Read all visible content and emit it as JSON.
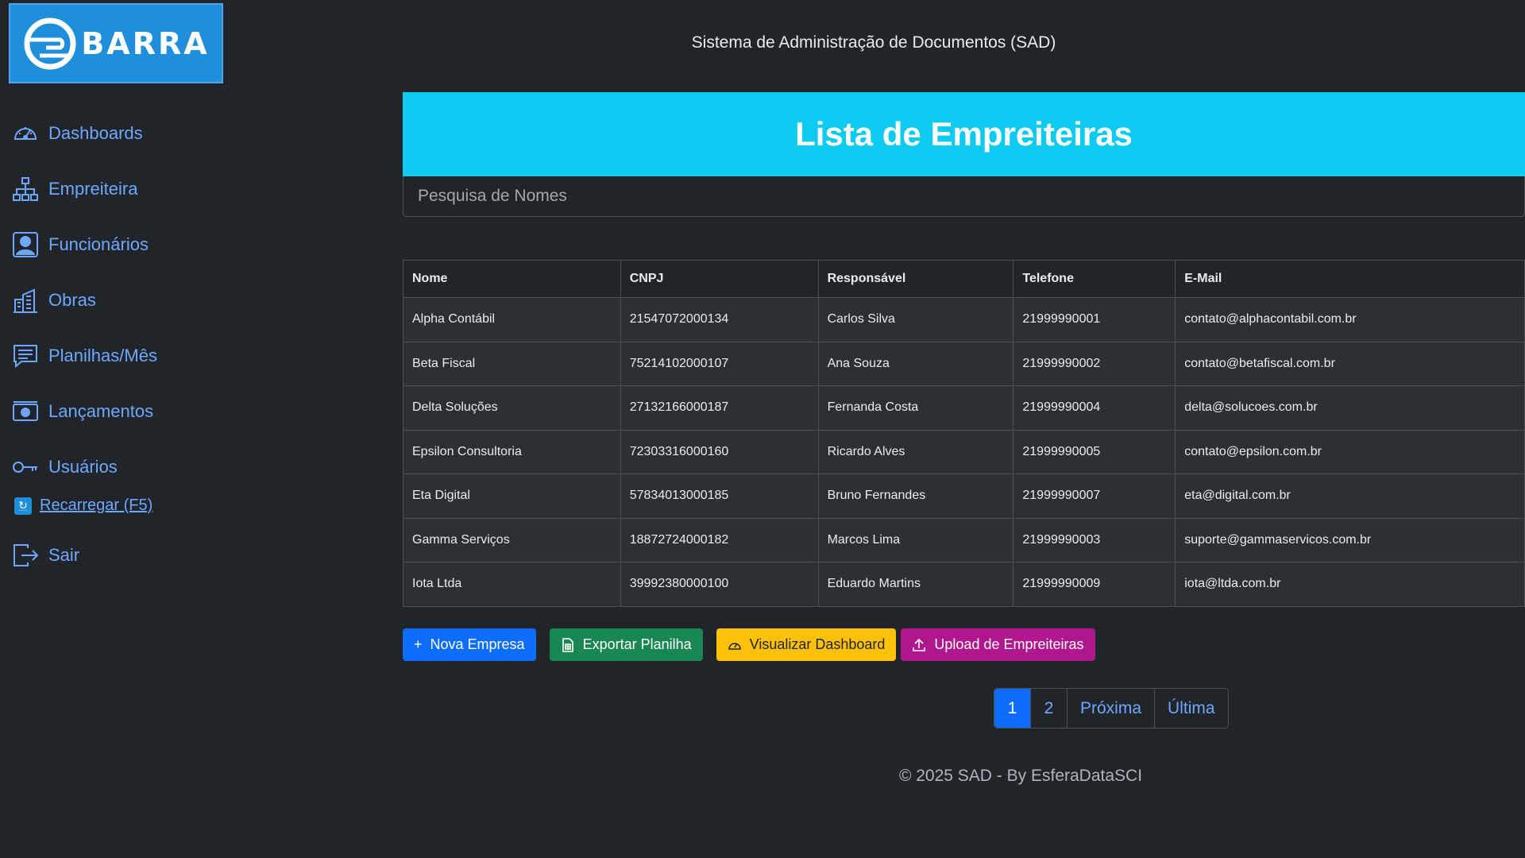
{
  "logo": {
    "text": "BARRA"
  },
  "header": {
    "system_title": "Sistema de Administração de Documentos (SAD)"
  },
  "sidebar": {
    "items": [
      {
        "label": "Dashboards",
        "icon": "speedometer-icon"
      },
      {
        "label": "Empreiteira",
        "icon": "org-chart-icon"
      },
      {
        "label": "Funcionários",
        "icon": "person-icon"
      },
      {
        "label": "Obras",
        "icon": "buildings-icon"
      },
      {
        "label": "Planilhas/Mês",
        "icon": "chat-lines-icon"
      },
      {
        "label": "Lançamentos",
        "icon": "cash-icon"
      },
      {
        "label": "Usuários",
        "icon": "key-icon"
      }
    ],
    "reload_label": "Recarregar (F5)",
    "logout_label": "Sair"
  },
  "main": {
    "title": "Lista de Empreiteiras",
    "search_placeholder": "Pesquisa de Nomes",
    "table": {
      "columns": [
        "Nome",
        "CNPJ",
        "Responsável",
        "Telefone",
        "E-Mail"
      ],
      "rows": [
        [
          "Alpha Contábil",
          "21547072000134",
          "Carlos Silva",
          "21999990001",
          "contato@alphacontabil.com.br"
        ],
        [
          "Beta Fiscal",
          "75214102000107",
          "Ana Souza",
          "21999990002",
          "contato@betafiscal.com.br"
        ],
        [
          "Delta Soluções",
          "27132166000187",
          "Fernanda Costa",
          "21999990004",
          "delta@solucoes.com.br"
        ],
        [
          "Epsilon Consultoria",
          "72303316000160",
          "Ricardo Alves",
          "21999990005",
          "contato@epsilon.com.br"
        ],
        [
          "Eta Digital",
          "57834013000185",
          "Bruno Fernandes",
          "21999990007",
          "eta@digital.com.br"
        ],
        [
          "Gamma Serviços",
          "18872724000182",
          "Marcos Lima",
          "21999990003",
          "suporte@gammaservicos.com.br"
        ],
        [
          "Iota Ltda",
          "39992380000100",
          "Eduardo Martins",
          "21999990009",
          "iota@ltda.com.br"
        ]
      ]
    },
    "actions": {
      "new_company": "Nova Empresa",
      "export": "Exportar Planilha",
      "dashboard": "Visualizar Dashboard",
      "upload": "Upload de Empreiteiras"
    },
    "pagination": {
      "pages": [
        "1",
        "2"
      ],
      "next": "Próxima",
      "last": "Última",
      "current": "1"
    }
  },
  "footer": {
    "text": "© 2025 SAD - By EsferaDataSCI"
  },
  "colors": {
    "background": "#212529",
    "banner": "#0dcaf0",
    "link": "#6ea8fe",
    "primary": "#0d6efd",
    "success": "#198754",
    "warning": "#ffc107",
    "upload": "#b0178f",
    "logo_bg": "#1f8fdc"
  }
}
